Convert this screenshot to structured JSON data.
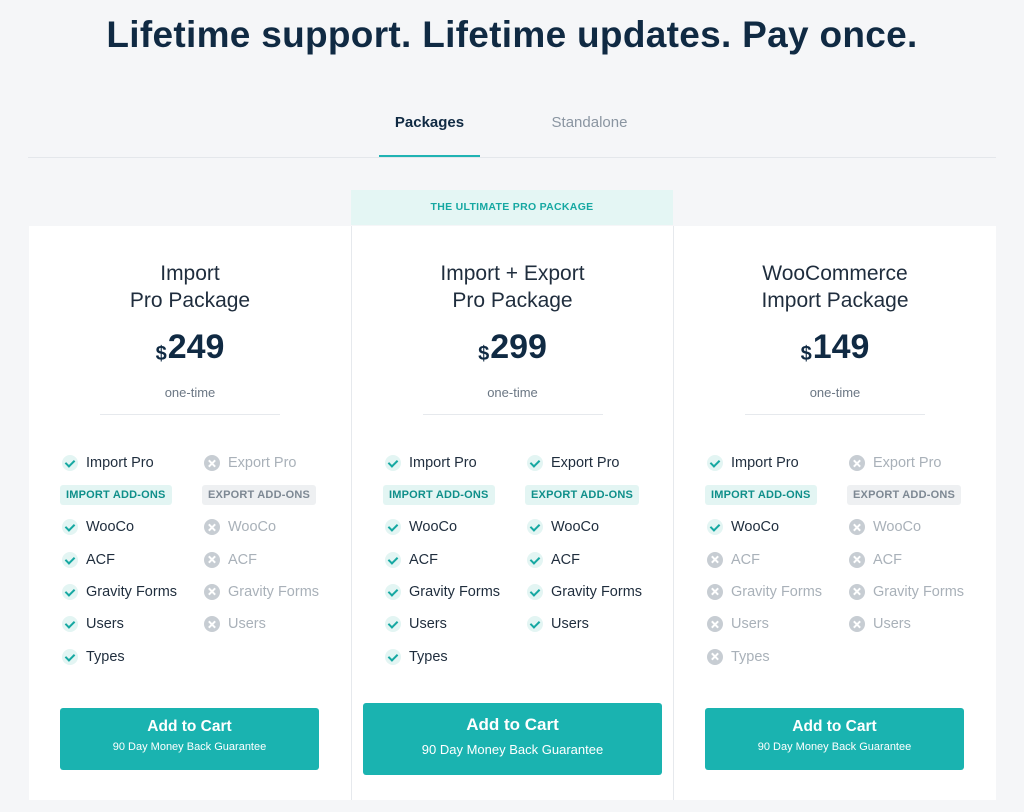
{
  "headline": "Lifetime support. Lifetime updates. Pay once.",
  "tabs": [
    {
      "label": "Packages",
      "active": true
    },
    {
      "label": "Standalone",
      "active": false
    }
  ],
  "ribbon": "THE ULTIMATE PRO PACKAGE",
  "colors": {
    "accent": "#1ab3b0",
    "headline": "#102a43",
    "disabled": "#a9b1b9"
  },
  "icons": {
    "included": "check-icon",
    "excluded": "cross-icon"
  },
  "cards": [
    {
      "title_line1": "Import",
      "title_line2": "Pro Package",
      "currency": "$",
      "price": "249",
      "billing": "one-time",
      "left": {
        "top": {
          "label": "Import Pro",
          "included": true
        },
        "addons_label": "IMPORT ADD-ONS",
        "addons_included": true,
        "items": [
          {
            "label": "WooCo",
            "included": true
          },
          {
            "label": "ACF",
            "included": true
          },
          {
            "label": "Gravity Forms",
            "included": true
          },
          {
            "label": "Users",
            "included": true
          },
          {
            "label": "Types",
            "included": true
          }
        ]
      },
      "right": {
        "top": {
          "label": "Export Pro",
          "included": false
        },
        "addons_label": "EXPORT ADD-ONS",
        "addons_included": false,
        "items": [
          {
            "label": "WooCo",
            "included": false
          },
          {
            "label": "ACF",
            "included": false
          },
          {
            "label": "Gravity Forms",
            "included": false
          },
          {
            "label": "Users",
            "included": false
          }
        ]
      },
      "button_label": "Add to Cart",
      "button_sub": "90 Day Money Back Guarantee"
    },
    {
      "title_line1": "Import + Export",
      "title_line2": "Pro Package",
      "currency": "$",
      "price": "299",
      "billing": "one-time",
      "left": {
        "top": {
          "label": "Import Pro",
          "included": true
        },
        "addons_label": "IMPORT ADD-ONS",
        "addons_included": true,
        "items": [
          {
            "label": "WooCo",
            "included": true
          },
          {
            "label": "ACF",
            "included": true
          },
          {
            "label": "Gravity Forms",
            "included": true
          },
          {
            "label": "Users",
            "included": true
          },
          {
            "label": "Types",
            "included": true
          }
        ]
      },
      "right": {
        "top": {
          "label": "Export Pro",
          "included": true
        },
        "addons_label": "EXPORT ADD-ONS",
        "addons_included": true,
        "items": [
          {
            "label": "WooCo",
            "included": true
          },
          {
            "label": "ACF",
            "included": true
          },
          {
            "label": "Gravity Forms",
            "included": true
          },
          {
            "label": "Users",
            "included": true
          }
        ]
      },
      "button_label": "Add to Cart",
      "button_sub": "90 Day Money Back Guarantee"
    },
    {
      "title_line1": "WooCommerce",
      "title_line2": "Import Package",
      "currency": "$",
      "price": "149",
      "billing": "one-time",
      "left": {
        "top": {
          "label": "Import Pro",
          "included": true
        },
        "addons_label": "IMPORT ADD-ONS",
        "addons_included": true,
        "items": [
          {
            "label": "WooCo",
            "included": true
          },
          {
            "label": "ACF",
            "included": false
          },
          {
            "label": "Gravity Forms",
            "included": false
          },
          {
            "label": "Users",
            "included": false
          },
          {
            "label": "Types",
            "included": false
          }
        ]
      },
      "right": {
        "top": {
          "label": "Export Pro",
          "included": false
        },
        "addons_label": "EXPORT ADD-ONS",
        "addons_included": false,
        "items": [
          {
            "label": "WooCo",
            "included": false
          },
          {
            "label": "ACF",
            "included": false
          },
          {
            "label": "Gravity Forms",
            "included": false
          },
          {
            "label": "Users",
            "included": false
          }
        ]
      },
      "button_label": "Add to Cart",
      "button_sub": "90 Day Money Back Guarantee"
    }
  ]
}
